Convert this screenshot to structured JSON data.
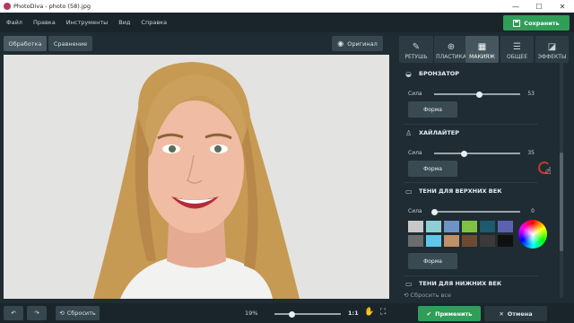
{
  "window": {
    "title": "PhotoDiva - photo (58).jpg",
    "minimize": "—",
    "maximize": "☐",
    "close": "✕"
  },
  "menu": [
    "Файл",
    "Правка",
    "Инструменты",
    "Вид",
    "Справка"
  ],
  "save_label": "Сохранить",
  "view_buttons": {
    "edit": "Обработка",
    "compare": "Сравнение",
    "original": "Оригинал"
  },
  "tabs": [
    {
      "label": "РЕТУШЬ",
      "icon": "retouch-icon"
    },
    {
      "label": "ПЛАСТИКА",
      "icon": "plastic-icon"
    },
    {
      "label": "МАКИЯЖ",
      "icon": "makeup-icon"
    },
    {
      "label": "ОБЩЕЕ",
      "icon": "sliders-icon"
    },
    {
      "label": "ЭФФЕКТЫ",
      "icon": "effects-icon"
    }
  ],
  "sections": {
    "bronzer": {
      "title": "БРОНЗАТОР",
      "strength_label": "Сила",
      "value": 53,
      "shape_label": "Форма"
    },
    "highlighter": {
      "title": "ХАЙЛАЙТЕР",
      "strength_label": "Сила",
      "value": 35,
      "shape_label": "Форма"
    },
    "upper_shadows": {
      "title": "ТЕНИ ДЛЯ ВЕРХНИХ ВЕК",
      "strength_label": "Сила",
      "value": 0,
      "shape_label": "Форма",
      "swatches": [
        "#c8c8c8",
        "#8ecfd4",
        "#6f93c6",
        "#7fc241",
        "#1c5a6e",
        "#5b62b0",
        "#6c6c6c",
        "#5fc6ea",
        "#c09066",
        "#6e4a32",
        "#3a3a3a",
        "#101010"
      ]
    },
    "lower_shadows": {
      "title": "ТЕНИ ДЛЯ НИЖНИХ ВЕК"
    }
  },
  "reset_all": "Сбросить все",
  "bottom": {
    "reset_label": "Сбросить",
    "zoom": "19%",
    "zoom_level": 0.26,
    "ratio": "1:1"
  },
  "apply_label": "Применить",
  "cancel_label": "Отмена"
}
